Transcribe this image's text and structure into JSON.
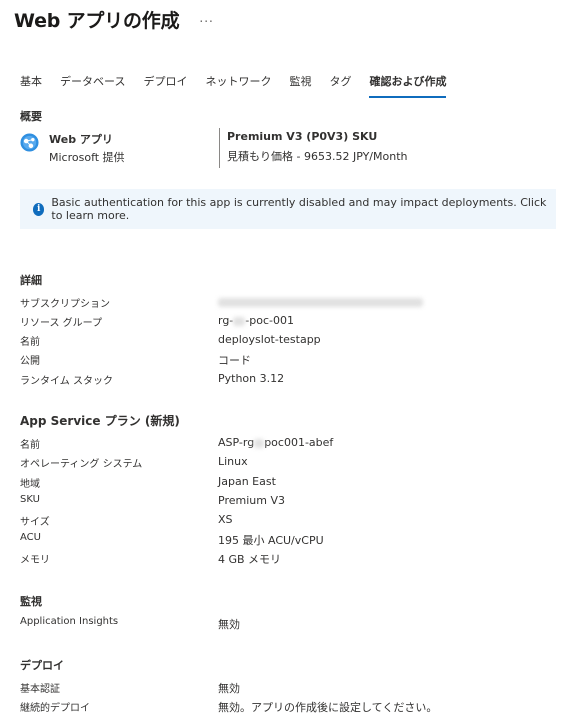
{
  "header": {
    "title": "Web アプリの作成",
    "more": "..."
  },
  "tabs": [
    {
      "label": "基本"
    },
    {
      "label": "データベース"
    },
    {
      "label": "デプロイ"
    },
    {
      "label": "ネットワーク"
    },
    {
      "label": "監視"
    },
    {
      "label": "タグ"
    },
    {
      "label": "確認および作成",
      "active": true
    }
  ],
  "overview": {
    "heading": "概要",
    "product_name": "Web アプリ",
    "provider": "Microsoft 提供",
    "product_icon": "web-app-icon",
    "sku_name": "Premium V3 (P0V3) SKU",
    "sku_price": "見積もり価格 - 9653.52 JPY/Month"
  },
  "banner": {
    "icon": "info-icon",
    "text": "Basic authentication for this app is currently disabled and may impact deployments. Click to learn more."
  },
  "details": {
    "heading": "詳細",
    "rows": [
      {
        "key": "サブスクリプション",
        "value": ""
      },
      {
        "key": "リソース グループ",
        "value_pre": "rg-",
        "value_post": "-poc-001"
      },
      {
        "key": "名前",
        "value": "deployslot-testapp"
      },
      {
        "key": "公開",
        "value": "コード"
      },
      {
        "key": "ランタイム スタック",
        "value": "Python 3.12"
      }
    ]
  },
  "app_service_plan": {
    "heading": "App Service プラン (新規)",
    "rows": [
      {
        "key": "名前",
        "value_pre": "ASP-rg",
        "value_post": "poc001-abef"
      },
      {
        "key": "オペレーティング システム",
        "value": "Linux"
      },
      {
        "key": "地域",
        "value": "Japan East"
      },
      {
        "key": "SKU",
        "value": "Premium V3"
      },
      {
        "key": "サイズ",
        "value": "XS"
      },
      {
        "key": "ACU",
        "value": "195 最小 ACU/vCPU"
      },
      {
        "key": "メモリ",
        "value": "4 GB メモリ"
      }
    ]
  },
  "monitoring": {
    "heading": "監視",
    "rows": [
      {
        "key": "Application Insights",
        "value": "無効"
      }
    ]
  },
  "deploy": {
    "heading": "デプロイ",
    "rows": [
      {
        "key": "基本認証",
        "value": "無効"
      },
      {
        "key": "継続的デプロイ",
        "value": "無効。アプリの作成後に設定してください。"
      }
    ]
  },
  "colors": {
    "accent": "#0f6cbd",
    "banner_bg": "#eff6fc"
  }
}
